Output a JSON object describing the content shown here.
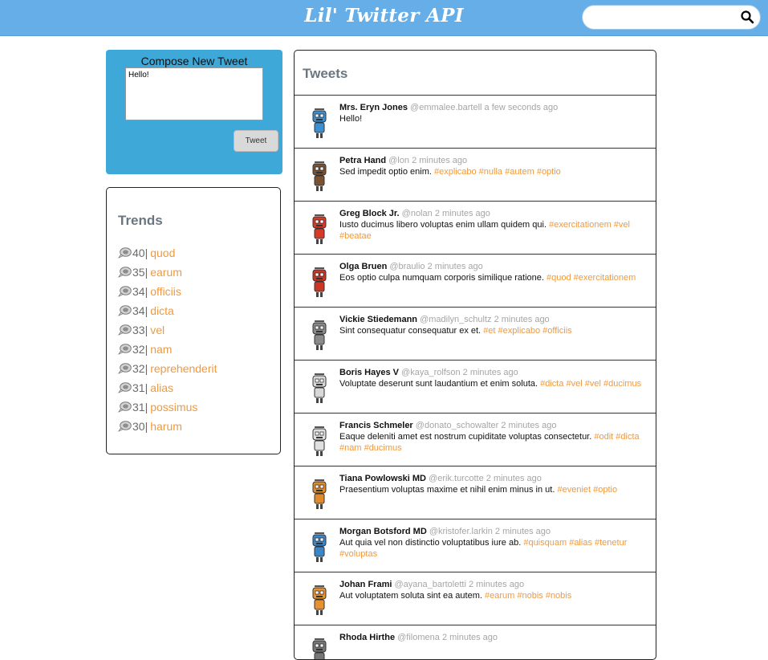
{
  "header": {
    "title": "Lil' Twitter API",
    "search_value": ""
  },
  "compose": {
    "title": "Compose New Tweet",
    "text": "Hello!",
    "button": "Tweet"
  },
  "trends": {
    "title": "Trends",
    "items": [
      {
        "count": "40|",
        "tag": "quod"
      },
      {
        "count": "35|",
        "tag": "earum"
      },
      {
        "count": "34|",
        "tag": "officiis"
      },
      {
        "count": "34|",
        "tag": "dicta"
      },
      {
        "count": "33|",
        "tag": "vel"
      },
      {
        "count": "32|",
        "tag": "nam"
      },
      {
        "count": "32|",
        "tag": "reprehenderit"
      },
      {
        "count": "31|",
        "tag": "alias"
      },
      {
        "count": "31|",
        "tag": "possimus"
      },
      {
        "count": "30|",
        "tag": "harum"
      }
    ]
  },
  "tweets": {
    "title": "Tweets",
    "items": [
      {
        "name": "Mrs. Eryn Jones",
        "handle": "@emmalee.bartell",
        "time": "a few seconds ago",
        "text": "Hello!",
        "tags": "",
        "avatar": "robot-blue-icon",
        "color": "#3c8fd0"
      },
      {
        "name": "Petra Hand",
        "handle": "@lon",
        "time": "2 minutes ago",
        "text": "Sed impedit optio enim.",
        "tags": "#explicabo #nulla #autem #optio",
        "avatar": "robot-brown-icon",
        "color": "#7a5232"
      },
      {
        "name": "Greg Block Jr.",
        "handle": "@nolan",
        "time": "2 minutes ago",
        "text": "Iusto ducimus libero voluptas enim ullam quidem qui.",
        "tags": "#exercitationem #vel #beatae",
        "avatar": "robot-red-icon",
        "color": "#d83a2a"
      },
      {
        "name": "Olga Bruen",
        "handle": "@braulio",
        "time": "2 minutes ago",
        "text": "Eos optio culpa numquam corporis similique ratione.",
        "tags": "#quod #exercitationem",
        "avatar": "robot-red-icon",
        "color": "#cc3524"
      },
      {
        "name": "Vickie Stiedemann",
        "handle": "@madilyn_schultz",
        "time": "2 minutes ago",
        "text": "Sint consequatur consequatur ex et.",
        "tags": "#et #explicabo #officiis",
        "avatar": "robot-gray-icon",
        "color": "#8a8a8a"
      },
      {
        "name": "Boris Hayes V",
        "handle": "@kaya_rolfson",
        "time": "2 minutes ago",
        "text": "Voluptate deserunt sunt laudantium et enim soluta.",
        "tags": "#dicta #vel #vel #ducimus",
        "avatar": "robot-white-icon",
        "color": "#d8d8d8"
      },
      {
        "name": "Francis Schmeler",
        "handle": "@donato_schowalter",
        "time": "2 minutes ago",
        "text": "Eaque deleniti amet est nostrum cupiditate voluptas consectetur.",
        "tags": "#odit #dicta #nam #ducimus",
        "avatar": "robot-white-icon",
        "color": "#e0e0e0"
      },
      {
        "name": "Tiana Powlowski MD",
        "handle": "@erik.turcotte",
        "time": "2 minutes ago",
        "text": "Praesentium voluptas maxime et nihil enim minus in ut.",
        "tags": "#eveniet #optio",
        "avatar": "robot-orange-icon",
        "color": "#e08a2a"
      },
      {
        "name": "Morgan Botsford MD",
        "handle": "@kristofer.larkin",
        "time": "2 minutes ago",
        "text": "Aut quia vel non distinctio voluptatibus iure ab.",
        "tags": "#quisquam #alias #tenetur #voluptas",
        "avatar": "robot-blue-icon",
        "color": "#3a86c8"
      },
      {
        "name": "Johan Frami",
        "handle": "@ayana_bartoletti",
        "time": "2 minutes ago",
        "text": "Aut voluptatem soluta sint ea autem.",
        "tags": "#earum #nobis #nobis",
        "avatar": "robot-orange-icon",
        "color": "#e8922e"
      },
      {
        "name": "Rhoda Hirthe",
        "handle": "@filomena",
        "time": "2 minutes ago",
        "text": "",
        "tags": "",
        "avatar": "robot-gray-icon",
        "color": "#777777"
      }
    ]
  }
}
